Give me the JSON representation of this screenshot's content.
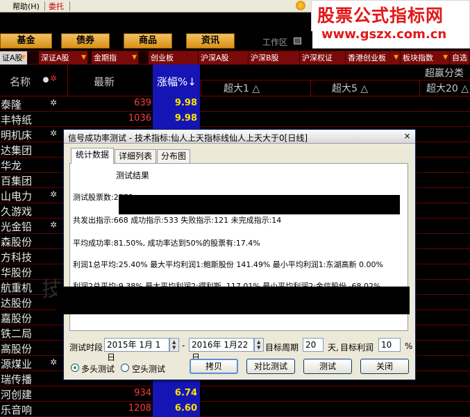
{
  "menubar": {
    "help": "帮助(H)",
    "entrust": "委托"
  },
  "watermark": {
    "line1": "股票公式指标网",
    "line2": "www.gszx.com.cn"
  },
  "categories": [
    "基金",
    "债券",
    "商品",
    "资讯"
  ],
  "workarea": "工作区",
  "tabs": [
    "证A股",
    "深证A股",
    "金期指",
    "创业板",
    "沪深A股",
    "沪深B股",
    "沪深权证",
    "香港创业板",
    "板块指数",
    "自选"
  ],
  "header": {
    "name": "名称",
    "latest": "最新",
    "change": "涨幅%↓",
    "super_group": "超赢分类",
    "col1": "超大1 △",
    "col2": "超大5 △",
    "col3": "超大20 △"
  },
  "stocks": [
    {
      "name": "泰隆",
      "price": "639",
      "change": "9.98"
    },
    {
      "name": "丰特纸",
      "price": "1036",
      "change": "9.98"
    },
    {
      "name": "明机床",
      "price": "",
      "change": ""
    },
    {
      "name": "达集团",
      "price": "",
      "change": ""
    },
    {
      "name": "华龙",
      "price": "",
      "change": ""
    },
    {
      "name": "百集团",
      "price": "",
      "change": ""
    },
    {
      "name": "山电力",
      "price": "",
      "change": ""
    },
    {
      "name": "久游戏",
      "price": "",
      "change": ""
    },
    {
      "name": "光金铅",
      "price": "",
      "change": ""
    },
    {
      "name": "森股份",
      "price": "",
      "change": ""
    },
    {
      "name": "方科技",
      "price": "",
      "change": ""
    },
    {
      "name": "华股份",
      "price": "",
      "change": ""
    },
    {
      "name": "航重机",
      "price": "",
      "change": ""
    },
    {
      "name": "达股份",
      "price": "",
      "change": ""
    },
    {
      "name": "嘉股份",
      "price": "",
      "change": ""
    },
    {
      "name": "铁二局",
      "price": "",
      "change": ""
    },
    {
      "name": "高股份",
      "price": "",
      "change": ""
    },
    {
      "name": "源煤业",
      "price": "",
      "change": ""
    },
    {
      "name": "瑞传播",
      "price": "",
      "change": ""
    },
    {
      "name": "河创建",
      "price": "934",
      "change": "6.74"
    },
    {
      "name": "乐音响",
      "price": "1208",
      "change": "6.60"
    }
  ],
  "dialog": {
    "title": "信号成功率测试 - 技术指标:仙人上天指标线仙人上天大于0[日线]",
    "close": "×",
    "tabs": [
      "统计数据",
      "详细列表",
      "分布图"
    ],
    "result_title": "测试结果",
    "lines": [
      "测试股票数:2773",
      "共发出指示:668 成功指示:533 失败指示:121 未完成指示:14",
      "平均成功率:81.50%, 成功率达到50%的股票有:17.4%",
      "利润1总平均:25.40% 最大平均利润1:鲍斯股份 141.49% 最小平均利润1:东湖高新 0.00%",
      "利润2总平均:9.38% 最大平均利润2:得利斯  117.01% 最小平均利润2:金信股份 -68.02%"
    ],
    "test_period_label": "测试时段",
    "date_start": "2015年  1月  1日",
    "dash": "-",
    "date_end": "2016年  1月22日",
    "target_period_label": "目标周期",
    "target_period": "20",
    "days_label": "天,",
    "target_profit_label": "目标利润",
    "target_profit": "10",
    "percent": "%",
    "radio_long": "多头测试",
    "radio_short": "空头测试",
    "buttons": {
      "copy": "拷贝",
      "compare": "对比测试",
      "test": "测试",
      "close": "关闭"
    }
  }
}
